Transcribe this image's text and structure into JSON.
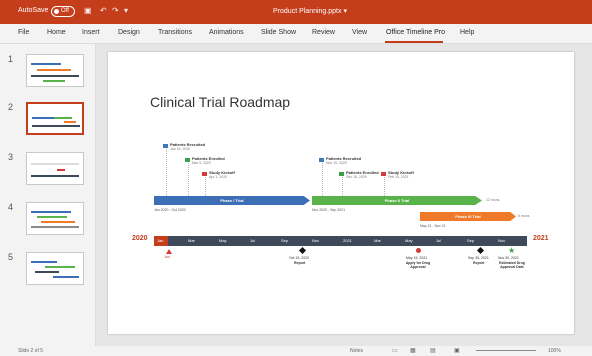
{
  "titlebar": {
    "autosave": "AutoSave",
    "toggle": "Off",
    "doc_title": "Product Planning.pptx ▾"
  },
  "ribbon": {
    "tabs": [
      "File",
      "Home",
      "Insert",
      "Design",
      "Transitions",
      "Animations",
      "Slide Show",
      "Review",
      "View",
      "Office Timeline Pro",
      "Help"
    ],
    "active_tab": "Office Timeline Pro"
  },
  "thumbnails": [
    "1",
    "2",
    "3",
    "4",
    "5"
  ],
  "selected_slide": 2,
  "slide": {
    "title": "Clinical Trial Roadmap",
    "milestones_top": [
      {
        "label": "Patients Recruited",
        "date": "Jan 15, 2020",
        "color": "#3d7ab8"
      },
      {
        "label": "Patients Enrolled",
        "date": "Mar 3, 2020",
        "color": "#3aa14a"
      },
      {
        "label": "Study Kickoff",
        "date": "Apr 1, 2020",
        "color": "#d33a3a"
      },
      {
        "label": "Patients Recruited",
        "date": "Nov 15, 2020",
        "color": "#3d7ab8"
      },
      {
        "label": "Patients Enrolled",
        "date": "Dec 15, 2020",
        "color": "#3aa14a"
      },
      {
        "label": "Study Kickoff",
        "date": "Feb 15, 2021",
        "color": "#d33a3a"
      }
    ],
    "bars": [
      {
        "label": "Phase I Trial",
        "range": "Jan 2020 - Oct 2020",
        "color": "#3d6fb6"
      },
      {
        "label": "Phase II Trial",
        "range": "Nov 2020 - Sep 2021",
        "duration": "12 mons",
        "color": "#5ab34a"
      },
      {
        "label": "Phase III Trial",
        "range": "May 21 - Nov 21",
        "duration": "6 mons",
        "color": "#ee7a2a"
      }
    ],
    "scale": {
      "start_year": "2020",
      "end_year": "2021",
      "months": [
        "Jan",
        "Mar",
        "May",
        "Jul",
        "Sep",
        "Nov",
        "2021",
        "Mar",
        "May",
        "Jul",
        "Sep",
        "Nov"
      ]
    },
    "bottom_milestones": [
      {
        "label": "",
        "date": "Jan",
        "shape": "triangle",
        "color": "#d33a3a"
      },
      {
        "label": "Report",
        "date": "Oct 15, 2020",
        "color": "#111111"
      },
      {
        "label": "Apply for Drug Approval",
        "date": "May 15, 2021",
        "color": "#d33a3a"
      },
      {
        "label": "Report",
        "date": "Sep 30, 2021",
        "color": "#111111"
      },
      {
        "label": "Estimated Drug Approval Date",
        "date": "Nov 30, 2021",
        "color": "#3aa14a"
      }
    ]
  },
  "statusbar": {
    "slide_info": "Slide 2 of 5",
    "notes": "Notes",
    "zoom": "100%"
  }
}
